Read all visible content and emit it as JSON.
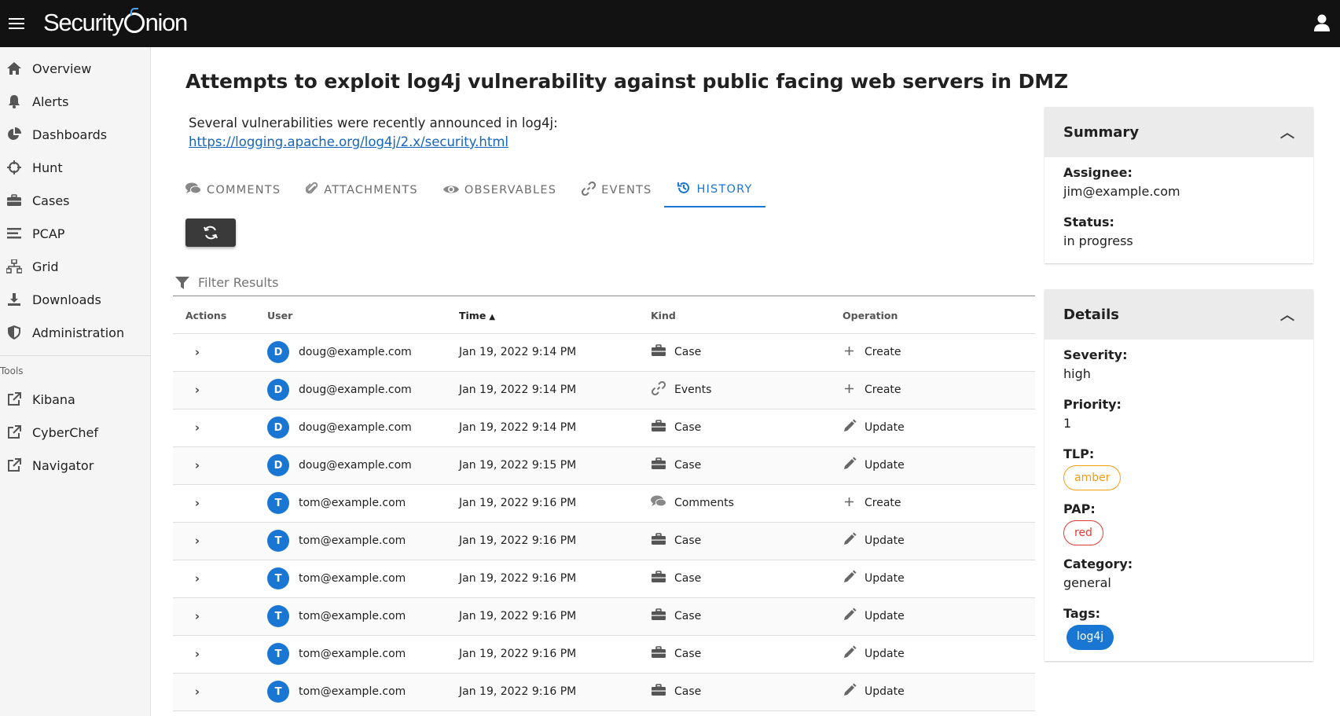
{
  "app": {
    "logo_prefix": "Security",
    "logo_suffix": "nion"
  },
  "nav": {
    "items": [
      {
        "label": "Overview",
        "icon": "home-icon"
      },
      {
        "label": "Alerts",
        "icon": "bell-icon"
      },
      {
        "label": "Dashboards",
        "icon": "pie-chart-icon"
      },
      {
        "label": "Hunt",
        "icon": "crosshairs-icon"
      },
      {
        "label": "Cases",
        "icon": "briefcase-icon"
      },
      {
        "label": "PCAP",
        "icon": "bars-icon"
      },
      {
        "label": "Grid",
        "icon": "network-icon"
      },
      {
        "label": "Downloads",
        "icon": "download-icon"
      },
      {
        "label": "Administration",
        "icon": "shield-icon"
      }
    ],
    "tools_label": "Tools",
    "tools": [
      {
        "label": "Kibana",
        "icon": "external-link-icon"
      },
      {
        "label": "CyberChef",
        "icon": "external-link-icon"
      },
      {
        "label": "Navigator",
        "icon": "external-link-icon"
      }
    ]
  },
  "case": {
    "title": "Attempts to exploit log4j vulnerability against public facing web servers in DMZ",
    "description": "Several vulnerabilities were recently announced in log4j:",
    "link": "https://logging.apache.org/log4j/2.x/security.html"
  },
  "tabs": [
    {
      "label": "Comments",
      "icon": "comments-icon",
      "active": false
    },
    {
      "label": "Attachments",
      "icon": "paperclip-icon",
      "active": false
    },
    {
      "label": "Observables",
      "icon": "eye-icon",
      "active": false
    },
    {
      "label": "Events",
      "icon": "link-icon",
      "active": false
    },
    {
      "label": "History",
      "icon": "history-icon",
      "active": true
    }
  ],
  "filter": {
    "placeholder": "Filter Results"
  },
  "table": {
    "headers": {
      "actions": "Actions",
      "user": "User",
      "time": "Time",
      "kind": "Kind",
      "operation": "Operation"
    },
    "sorted_by": "Time",
    "rows": [
      {
        "initial": "D",
        "user": "doug@example.com",
        "time": "Jan 19, 2022 9:14 PM",
        "kind": "Case",
        "kind_icon": "briefcase-icon",
        "op": "Create",
        "op_icon": "plus-icon"
      },
      {
        "initial": "D",
        "user": "doug@example.com",
        "time": "Jan 19, 2022 9:14 PM",
        "kind": "Events",
        "kind_icon": "link-icon",
        "op": "Create",
        "op_icon": "plus-icon"
      },
      {
        "initial": "D",
        "user": "doug@example.com",
        "time": "Jan 19, 2022 9:14 PM",
        "kind": "Case",
        "kind_icon": "briefcase-icon",
        "op": "Update",
        "op_icon": "pencil-icon"
      },
      {
        "initial": "D",
        "user": "doug@example.com",
        "time": "Jan 19, 2022 9:15 PM",
        "kind": "Case",
        "kind_icon": "briefcase-icon",
        "op": "Update",
        "op_icon": "pencil-icon"
      },
      {
        "initial": "T",
        "user": "tom@example.com",
        "time": "Jan 19, 2022 9:16 PM",
        "kind": "Comments",
        "kind_icon": "comments-icon",
        "op": "Create",
        "op_icon": "plus-icon"
      },
      {
        "initial": "T",
        "user": "tom@example.com",
        "time": "Jan 19, 2022 9:16 PM",
        "kind": "Case",
        "kind_icon": "briefcase-icon",
        "op": "Update",
        "op_icon": "pencil-icon"
      },
      {
        "initial": "T",
        "user": "tom@example.com",
        "time": "Jan 19, 2022 9:16 PM",
        "kind": "Case",
        "kind_icon": "briefcase-icon",
        "op": "Update",
        "op_icon": "pencil-icon"
      },
      {
        "initial": "T",
        "user": "tom@example.com",
        "time": "Jan 19, 2022 9:16 PM",
        "kind": "Case",
        "kind_icon": "briefcase-icon",
        "op": "Update",
        "op_icon": "pencil-icon"
      },
      {
        "initial": "T",
        "user": "tom@example.com",
        "time": "Jan 19, 2022 9:16 PM",
        "kind": "Case",
        "kind_icon": "briefcase-icon",
        "op": "Update",
        "op_icon": "pencil-icon"
      },
      {
        "initial": "T",
        "user": "tom@example.com",
        "time": "Jan 19, 2022 9:16 PM",
        "kind": "Case",
        "kind_icon": "briefcase-icon",
        "op": "Update",
        "op_icon": "pencil-icon"
      }
    ]
  },
  "summary": {
    "title": "Summary",
    "assignee_label": "Assignee:",
    "assignee": "jim@example.com",
    "status_label": "Status:",
    "status": "in progress"
  },
  "details": {
    "title": "Details",
    "severity_label": "Severity:",
    "severity": "high",
    "priority_label": "Priority:",
    "priority": "1",
    "tlp_label": "TLP:",
    "tlp": "amber",
    "pap_label": "PAP:",
    "pap": "red",
    "category_label": "Category:",
    "category": "general",
    "tags_label": "Tags:",
    "tags": [
      "log4j"
    ]
  },
  "colors": {
    "accent": "#1976d2",
    "appbar": "#121212",
    "amber": "#f39c12",
    "red": "#e53935"
  }
}
